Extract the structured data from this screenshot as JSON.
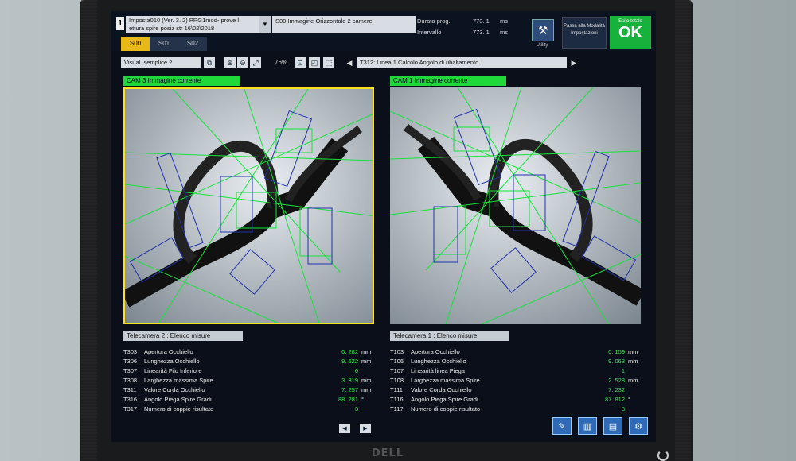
{
  "header": {
    "window_number": "1",
    "program_line1": "Imposta010  (Ver. 3. 2)  PRG1mod- prove l",
    "program_line2": "ettura spire posiz str 16\\02\\2018",
    "image_selector": "S00:Immagine Orizzontale 2 camere",
    "durata_label": "Durata prog.",
    "durata_value": "773. 1",
    "durata_unit": "ms",
    "intervallo_label": "Intervallo",
    "intervallo_value": "773. 1",
    "intervallo_unit": "ms",
    "utility_label": "Utility",
    "passa_label": "Passa alla Modalità Impostazioni",
    "esito_label": "Esito totale",
    "esito_value": "OK"
  },
  "tabs": [
    "S00",
    "S01",
    "S02"
  ],
  "toolbar": {
    "visual_select": "Visual.  semplice 2",
    "zoom": "76%",
    "test_select": "T312: Linea  1  Calcolo  Angolo di ribaltamento"
  },
  "cam_left": {
    "title": "CAM 3  Immagine corrente"
  },
  "cam_right": {
    "title": "CAM 1  Immagine corrente"
  },
  "measures_left": {
    "title": "Telecamera  2 : Elenco  misure",
    "rows": [
      {
        "code": "T303",
        "name": "Apertura Occhiello",
        "value": "0. 282",
        "unit": "mm"
      },
      {
        "code": "T306",
        "name": "Lunghezza Occhiello",
        "value": "9. 622",
        "unit": "mm"
      },
      {
        "code": "T307",
        "name": "Linearità Filo Inferiore",
        "value": "0",
        "unit": ""
      },
      {
        "code": "T308",
        "name": "Larghezza massima Spire",
        "value": "3. 319",
        "unit": "mm"
      },
      {
        "code": "T311",
        "name": "Valore Corda Occhiello",
        "value": "7. 257",
        "unit": "mm"
      },
      {
        "code": "T316",
        "name": "Angolo Piega Spire Gradi",
        "value": "88. 281",
        "unit": "°"
      },
      {
        "code": "T317",
        "name": "Numero di coppie risultato",
        "value": "3",
        "unit": ""
      }
    ]
  },
  "measures_right": {
    "title": "Telecamera  1 : Elenco  misure",
    "rows": [
      {
        "code": "T103",
        "name": "Apertura Occhiello",
        "value": "0. 159",
        "unit": "mm"
      },
      {
        "code": "T106",
        "name": "Lunghezza Occhiello",
        "value": "9. 063",
        "unit": "mm"
      },
      {
        "code": "T107",
        "name": "Linearità linea Piega",
        "value": "1",
        "unit": ""
      },
      {
        "code": "T108",
        "name": "Larghezza massima Spire",
        "value": "2. 528",
        "unit": "mm"
      },
      {
        "code": "T111",
        "name": "Valore Corda Occhiello",
        "value": "7. 232",
        "unit": ""
      },
      {
        "code": "T116",
        "name": "Angolo Piega Spire Gradi",
        "value": "87. 812",
        "unit": "°"
      },
      {
        "code": "T117",
        "name": "Numero di coppie risultato",
        "value": "3",
        "unit": ""
      }
    ]
  },
  "monitor_brand": "DELL",
  "colors": {
    "accent_green": "#1fd83a",
    "ok_green": "#16b23c",
    "tab_active": "#e8b819",
    "frame_yellow": "#ffe11a"
  }
}
